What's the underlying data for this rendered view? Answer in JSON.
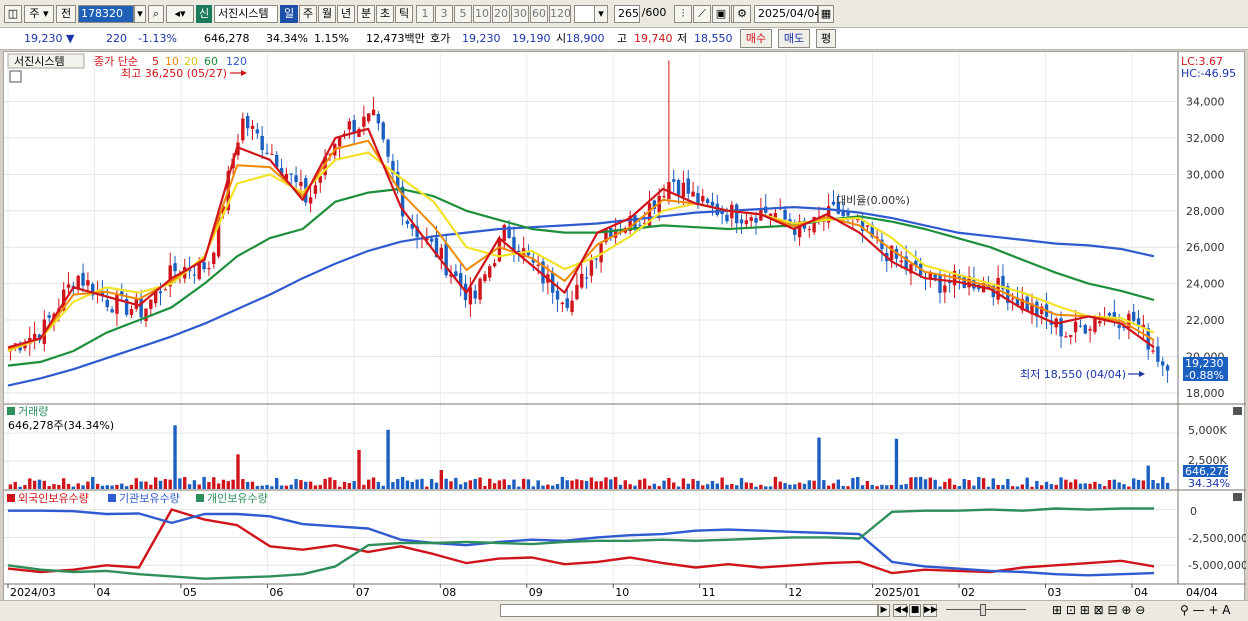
{
  "toolbar": {
    "type_menu": "주",
    "prev_label": "전",
    "code": "178320",
    "new_badge": "신",
    "stock_name": "서진시스템",
    "periods": [
      "일",
      "주",
      "월",
      "년",
      "분",
      "초",
      "틱"
    ],
    "active_period": "일",
    "minutes": [
      "1",
      "3",
      "5",
      "10",
      "20",
      "30",
      "60",
      "120"
    ],
    "count": "265",
    "count_max": "/600",
    "date": "2025/04/04"
  },
  "quote": {
    "price": "19,230",
    "change_arrow": "▼",
    "change": "220",
    "change_pct": "-1.13%",
    "volume": "646,278",
    "vol_ratio": "34.34%",
    "turnover": "1.15%",
    "amount": "12,473백만",
    "ask_label": "호가",
    "ask1": "19,230",
    "ask2": "19,190",
    "open_label": "시",
    "open": "18,900",
    "high_label": "고",
    "high": "19,740",
    "low_label": "저",
    "low": "18,550",
    "buy_btn": "매수",
    "sell_btn": "매도",
    "eval_btn": "평"
  },
  "price_panel": {
    "title_tab": "서진시스템",
    "ma_label": "종가 단순",
    "ma_periods": [
      "5",
      "10",
      "20",
      "60",
      "120"
    ],
    "high_annot": "최고 36,250 (05/27)",
    "low_annot": "최저 18,550 (04/04)",
    "mid_annot": "대비율(0.00%)",
    "lc": "LC:3.67",
    "hc": "HC:-46.95",
    "y_ticks": [
      "34,000",
      "32,000",
      "30,000",
      "28,000",
      "26,000",
      "24,000",
      "22,000",
      "20,000",
      "18,000"
    ],
    "cur_price": "19,230",
    "cur_pct": "-0.88%"
  },
  "volume_panel": {
    "title": "거래량",
    "sub": "646,278주(34.34%)",
    "y_ticks": [
      "5,000K",
      "2,500K"
    ],
    "cur": "646,278",
    "cur_pct": "34.34%"
  },
  "holding_panel": {
    "labels": [
      "외국인보유수량",
      "기관보유수량",
      "개인보유수량"
    ],
    "y_ticks": [
      "0",
      "-2,500,000",
      "-5,000,000"
    ]
  },
  "x_axis": {
    "labels": [
      "2024/03",
      "04",
      "05",
      "06",
      "07",
      "08",
      "09",
      "10",
      "11",
      "12",
      "2025/01",
      "02",
      "03",
      "04"
    ],
    "right_label": "04/04"
  },
  "colors": {
    "up": "#d0141b",
    "down": "#1b5fc0",
    "ma5": "#d0141b",
    "ma10": "#f08a00",
    "ma20": "#f2e22a",
    "ma60": "#1d8f3a",
    "ma120": "#2f5ad0",
    "foreign": "#d0141b",
    "inst": "#2f5ad0",
    "indiv": "#2e8f5a"
  },
  "chart_data": [
    {
      "type": "candlestick",
      "x": [
        "2024/03",
        "04",
        "05",
        "06",
        "07",
        "08",
        "09",
        "10",
        "11",
        "12",
        "2025/01",
        "02",
        "03",
        "04"
      ],
      "close_path": [
        20500,
        21500,
        24500,
        23000,
        22500,
        24800,
        25000,
        33000,
        31000,
        28500,
        32500,
        33000,
        27500,
        25500,
        23000,
        27000,
        24500,
        23000,
        27000,
        27500,
        29800,
        28200,
        27800,
        28000,
        26800,
        28000,
        26500,
        25000,
        24000,
        24200,
        23700,
        22500,
        21200,
        22300,
        22000,
        19230
      ],
      "ma5": [
        20500,
        21000,
        23800,
        23300,
        22800,
        24300,
        25300,
        31500,
        30800,
        28600,
        32000,
        32500,
        28200,
        25800,
        23500,
        26500,
        25000,
        23500,
        26800,
        27600,
        29200,
        28400,
        28000,
        27800,
        27000,
        27800,
        26800,
        25200,
        24300,
        24100,
        23700,
        22600,
        21800,
        22200,
        21800,
        20500
      ],
      "ma20": [
        20300,
        21000,
        23000,
        23800,
        23500,
        24000,
        25500,
        29500,
        30000,
        29000,
        30800,
        31200,
        29800,
        28500,
        26000,
        25500,
        25800,
        24800,
        25500,
        26600,
        28000,
        28400,
        28000,
        27800,
        27300,
        27500,
        27600,
        26500,
        25000,
        24500,
        24000,
        23500,
        22800,
        22200,
        22100,
        21300
      ],
      "ma60": [
        19500,
        19700,
        20300,
        21300,
        22000,
        22700,
        24000,
        25500,
        26500,
        27000,
        28500,
        29000,
        29200,
        28800,
        28000,
        27500,
        27000,
        26800,
        26800,
        27000,
        27200,
        27100,
        27000,
        27100,
        27200,
        27500,
        27700,
        27400,
        27000,
        26500,
        26000,
        25300,
        24600,
        24000,
        23600,
        23100
      ],
      "ma120": [
        18400,
        18800,
        19300,
        19900,
        20500,
        21100,
        21800,
        22600,
        23400,
        24300,
        25100,
        25800,
        26300,
        26600,
        26800,
        27000,
        27100,
        27200,
        27300,
        27500,
        27700,
        27900,
        28000,
        28100,
        28200,
        28100,
        27900,
        27600,
        27200,
        26800,
        26600,
        26400,
        26200,
        26100,
        25900,
        25500
      ],
      "high": 36250,
      "low": 18550,
      "ylim": [
        17500,
        36500
      ]
    },
    {
      "type": "bar",
      "series_name": "거래량",
      "big_bars": [
        [
          168,
          5700
        ],
        [
          380,
          5300
        ],
        [
          888,
          4500
        ],
        [
          813,
          4600
        ],
        [
          1140,
          2100
        ],
        [
          232,
          3100
        ],
        [
          351,
          3500
        ],
        [
          437,
          1700
        ]
      ]
    },
    {
      "type": "line",
      "series": [
        {
          "name": "외국인보유수량",
          "values": [
            -5300000,
            -5600000,
            -5400000,
            -5000000,
            -5200000,
            4000,
            -900000,
            -1400000,
            -3300000,
            -3600000,
            -3200000,
            -3800000,
            -3300000,
            -4000000,
            -4800000,
            -4400000,
            -4300000,
            -4900000,
            -4700000,
            -4300000,
            -4800000,
            -5200000,
            -4900000,
            -5200000,
            -5000000,
            -4800000,
            -4700000,
            -5700000,
            -5400000,
            -5500000,
            -5600000,
            -5200000,
            -5000000,
            -4800000,
            -4600000,
            -5100000
          ]
        },
        {
          "name": "기관보유수량",
          "values": [
            -100000,
            -100000,
            -150000,
            -400000,
            -350000,
            -1200000,
            -400000,
            -400000,
            -600000,
            -1300000,
            -1500000,
            -1700000,
            -2700000,
            -3000000,
            -3200000,
            -2900000,
            -2700000,
            -2800000,
            -2500000,
            -2300000,
            -2200000,
            -1900000,
            -1800000,
            -1900000,
            -2000000,
            -2100000,
            -2200000,
            -4700000,
            -5100000,
            -5300000,
            -5500000,
            -5600000,
            -5800000,
            -5900000,
            -5800000,
            -5700000
          ]
        },
        {
          "name": "개인보유수량",
          "values": [
            -5000000,
            -5400000,
            -5600000,
            -5500000,
            -5800000,
            -6000000,
            -6200000,
            -6100000,
            -6000000,
            -5800000,
            -5100000,
            -3200000,
            -3000000,
            -3000000,
            -2900000,
            -3000000,
            -3100000,
            -2900000,
            -2800000,
            -2800000,
            -2700000,
            -2800000,
            -2700000,
            -2600000,
            -2500000,
            -2500000,
            -2600000,
            -200000,
            -100000,
            -100000,
            0,
            -100000,
            100000,
            0,
            100000,
            100000
          ]
        }
      ],
      "ylim": [
        -6500000,
        500000
      ]
    }
  ]
}
